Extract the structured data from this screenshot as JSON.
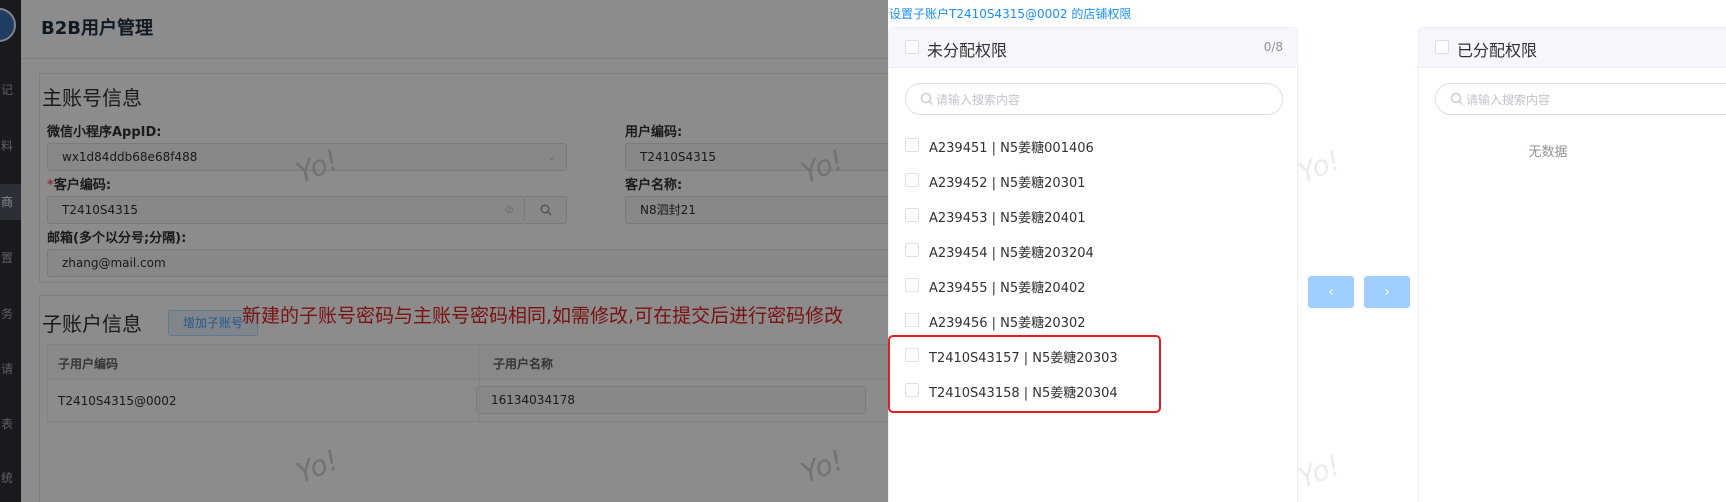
{
  "page": {
    "title": "B2B用户管理"
  },
  "sidebar": {
    "items": [
      "记",
      "料",
      "商",
      "置",
      "务",
      "请",
      "表",
      "统"
    ]
  },
  "main_account": {
    "section_title": "主账号信息",
    "appid_label": "微信小程序AppID:",
    "appid_value": "wx1d84ddb68e68f488",
    "user_code_label": "用户编码:",
    "user_code_value": "T2410S4315",
    "customer_code_label": "客户编码:",
    "customer_code_required": "*",
    "customer_code_value": "T2410S4315",
    "customer_name_label": "客户名称:",
    "customer_name_value": "N8泗封21",
    "email_label": "邮箱(多个以分号;分隔):",
    "email_value": "zhang@mail.com"
  },
  "sub_account": {
    "section_title": "子账户信息",
    "add_button": "增加子账号",
    "notice": "新建的子账号密码与主账号密码相同,如需修改,可在提交后进行密码修改",
    "columns": [
      "子用户编码",
      "子用户名称"
    ],
    "rows": [
      {
        "code": "T2410S4315@0002",
        "name": "16134034178"
      }
    ]
  },
  "watermark": "Yo!",
  "drawer": {
    "title": "设置子账户T2410S4315@0002 的店铺权限",
    "left_panel": {
      "title": "未分配权限",
      "count": "0/8",
      "search_placeholder": "请输入搜索内容",
      "items": [
        "A239451 | N5姜糖001406",
        "A239452 | N5姜糖20301",
        "A239453 | N5姜糖20401",
        "A239454 | N5姜糖203204",
        "A239455 | N5姜糖20402",
        "A239456 | N5姜糖20302",
        "T2410S43157 | N5姜糖20303",
        "T2410S43158 | N5姜糖20304"
      ]
    },
    "right_panel": {
      "title": "已分配权限",
      "search_placeholder": "请输入搜索内容",
      "empty_text": "无数据"
    },
    "transfer_left_label": "‹",
    "transfer_right_label": "›"
  },
  "colors": {
    "accent": "#409eff",
    "highlight": "#e11f1f",
    "title_link": "#1890ff"
  }
}
